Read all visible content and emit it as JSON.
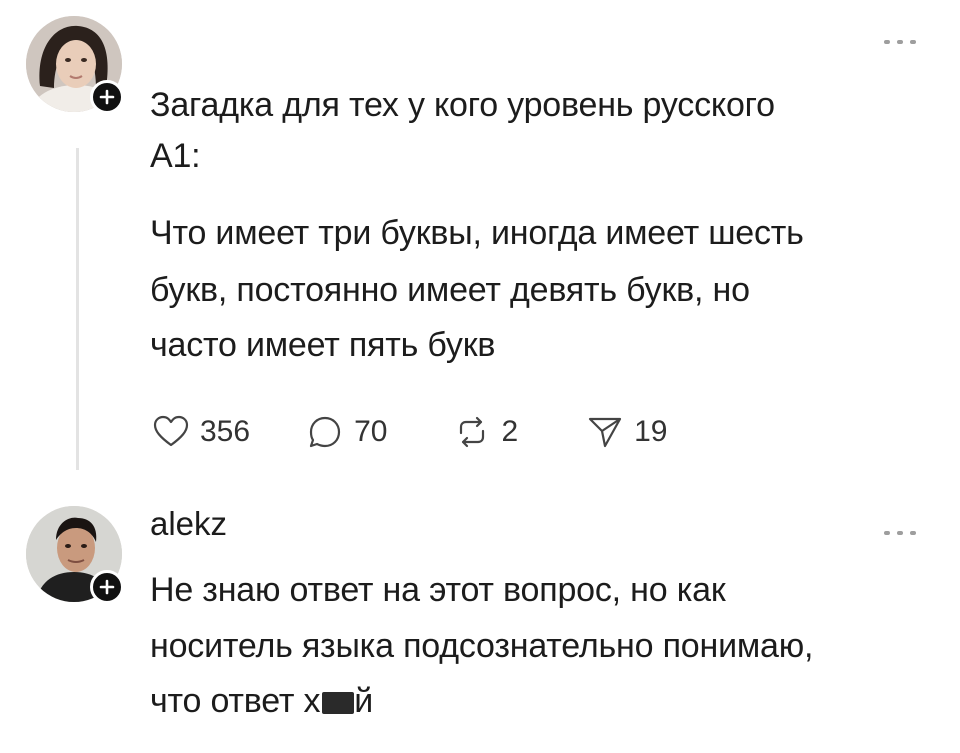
{
  "post": {
    "title_line1": "Загадка для тех у кого уровень русского",
    "title_line2": "А1:",
    "body_line1": "Что имеет три буквы, иногда имеет шесть",
    "body_line2": "букв, постоянно имеет девять букв, но",
    "body_line3": "часто имеет пять букв",
    "likes": "356",
    "comments": "70",
    "reposts": "2",
    "shares": "19"
  },
  "reply": {
    "username": "alekz",
    "line1": "Не знаю ответ на этот вопрос, но как",
    "line2": "носитель языка подсознательно понимаю,",
    "line3_prefix": "что ответ х",
    "line3_suffix": "й"
  }
}
